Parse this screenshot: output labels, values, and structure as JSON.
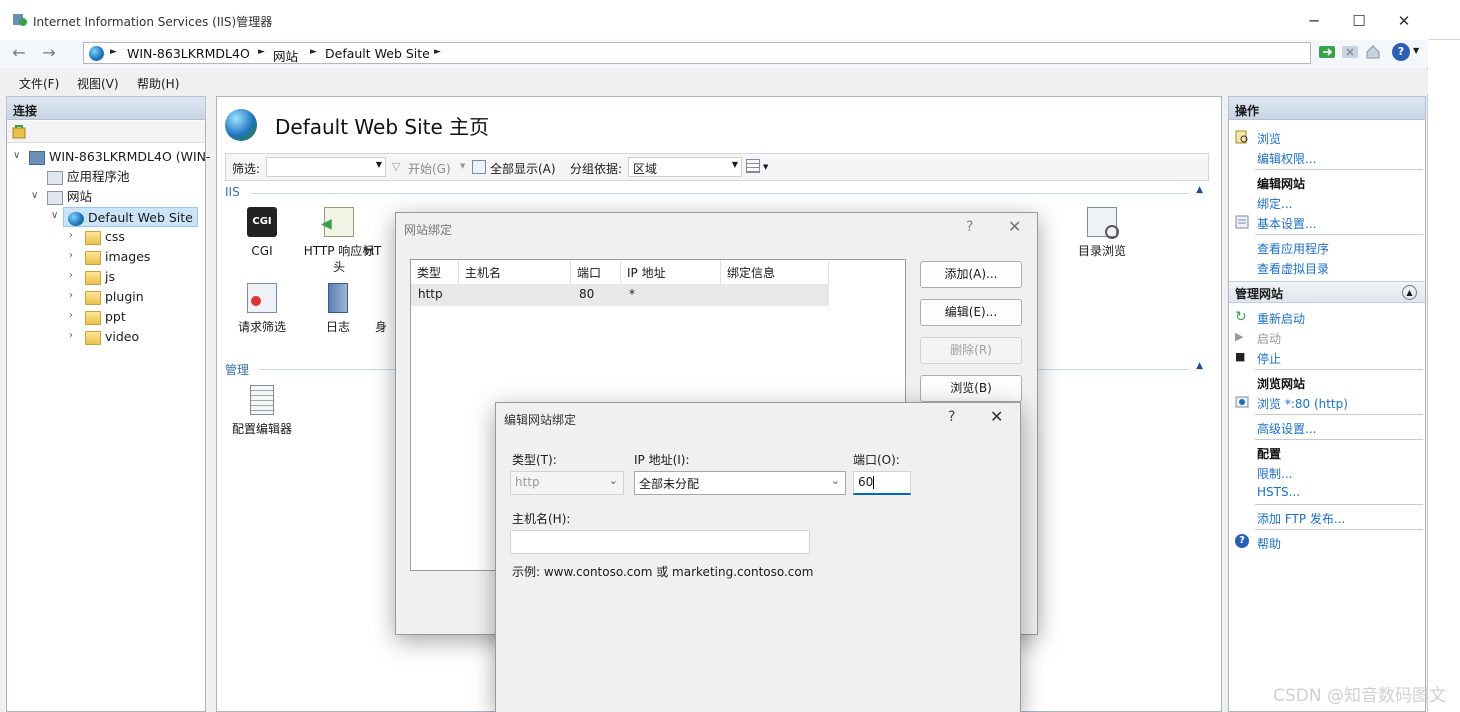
{
  "window": {
    "title": "Internet Information Services (IIS)管理器",
    "minimize": "─",
    "maximize": "☐",
    "close": "✕"
  },
  "address": {
    "crumbs": [
      "WIN-863LKRMDL4O",
      "网站",
      "Default Web Site"
    ],
    "sep": "►",
    "help": "?"
  },
  "menu": [
    "文件(F)",
    "视图(V)",
    "帮助(H)"
  ],
  "left": {
    "header": "连接",
    "tree": {
      "server": "WIN-863LKRMDL4O (WIN-",
      "app_pools": "应用程序池",
      "sites": "网站",
      "site": "Default Web Site",
      "folders": [
        "css",
        "images",
        "js",
        "plugin",
        "ppt",
        "video"
      ]
    }
  },
  "center": {
    "title": "Default Web Site 主页",
    "filter_label": "筛选:",
    "start_label": "开始(G)",
    "show_all_label": "全部显示(A)",
    "group_label": "分组依据:",
    "group_value": "区域",
    "section_iis": "IIS",
    "section_manage": "管理",
    "features": [
      "CGI",
      "HTTP 响应标头",
      "HT",
      "请求筛选",
      "日志",
      "身",
      "目录浏览",
      "配置编辑器"
    ]
  },
  "right": {
    "header": "操作",
    "browse": "浏览",
    "edit_perm": "编辑权限...",
    "edit_site_head": "编辑网站",
    "bindings": "绑定...",
    "basic_settings": "基本设置...",
    "view_apps": "查看应用程序",
    "view_vdirs": "查看虚拟目录",
    "manage_head": "管理网站",
    "restart": "重新启动",
    "start": "启动",
    "stop": "停止",
    "browse_head": "浏览网站",
    "browse_80": "浏览 *:80 (http)",
    "advanced": "高级设置...",
    "config_head": "配置",
    "limits": "限制...",
    "hsts": "HSTS...",
    "ftp": "添加 FTP 发布...",
    "help": "帮助"
  },
  "bindings_dialog": {
    "title": "网站绑定",
    "help": "?",
    "close": "✕",
    "columns": [
      "类型",
      "主机名",
      "端口",
      "IP 地址",
      "绑定信息"
    ],
    "row": {
      "type": "http",
      "host": "",
      "port": "80",
      "ip": "*",
      "info": ""
    },
    "buttons": {
      "add": "添加(A)...",
      "edit": "编辑(E)...",
      "remove": "删除(R)",
      "browse": "浏览(B)"
    }
  },
  "edit_dialog": {
    "title": "编辑网站绑定",
    "help": "?",
    "close": "✕",
    "type_label": "类型(T):",
    "type_value": "http",
    "ip_label": "IP 地址(I):",
    "ip_value": "全部未分配",
    "port_label": "端口(O):",
    "port_value": "60",
    "host_label": "主机名(H):",
    "host_value": "",
    "example": "示例: www.contoso.com 或 marketing.contoso.com"
  },
  "watermark": "CSDN @知音数码图文"
}
